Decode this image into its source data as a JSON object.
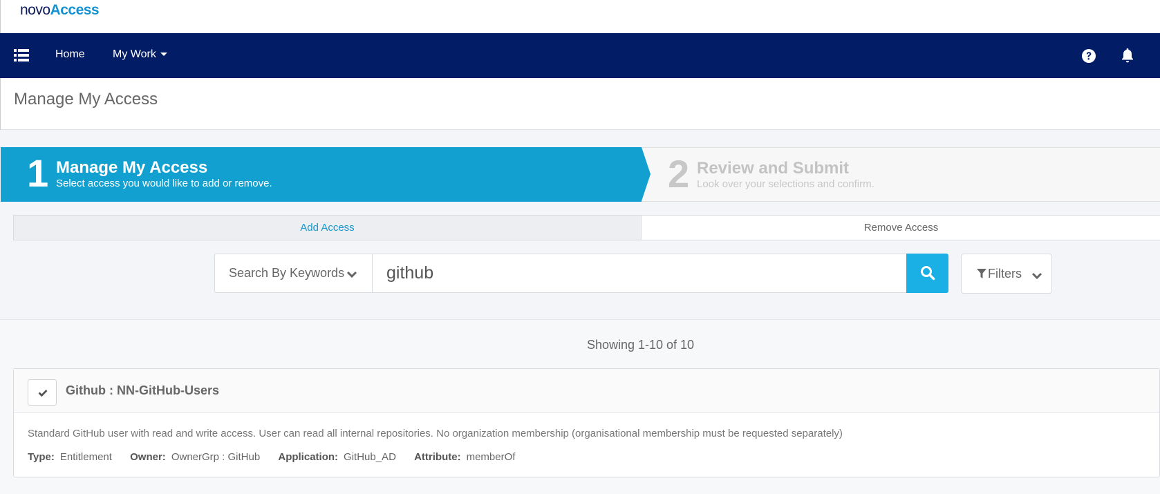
{
  "brand": {
    "prefix": "novo",
    "suffix": "Access"
  },
  "nav": {
    "home": "Home",
    "my_work": "My Work",
    "icons": [
      "list-menu-icon",
      "help-icon",
      "bell-icon"
    ]
  },
  "page": {
    "title": "Manage My Access"
  },
  "stepper": {
    "steps": [
      {
        "number": "1",
        "title": "Manage My Access",
        "subtitle": "Select access you would like to add or remove.",
        "active": true
      },
      {
        "number": "2",
        "title": "Review and Submit",
        "subtitle": "Look over your selections and confirm.",
        "active": false
      }
    ]
  },
  "tabs": {
    "add": "Add Access",
    "remove": "Remove Access",
    "selected": "Add Access"
  },
  "search": {
    "type_label": "Search By Keywords",
    "value": "github",
    "filters_label": "Filters"
  },
  "results": {
    "summary": "Showing 1-10 of 10",
    "items": [
      {
        "title": "Github : NN-GitHub-Users",
        "description": "Standard GitHub user with read and write access. User can read all internal repositories. No organization membership (organisational membership must be requested separately)",
        "meta": {
          "type_label": "Type:",
          "type": "Entitlement",
          "owner_label": "Owner:",
          "owner": "OwnerGrp : GitHub",
          "application_label": "Application:",
          "application": "GitHub_AD",
          "attribute_label": "Attribute:",
          "attribute": "memberOf"
        }
      }
    ]
  },
  "colors": {
    "nav_bg": "#031c66",
    "accent": "#12a0d1",
    "search_button": "#1ab0e6",
    "brand_dark": "#0d1b5e",
    "brand_light": "#1493d0"
  }
}
